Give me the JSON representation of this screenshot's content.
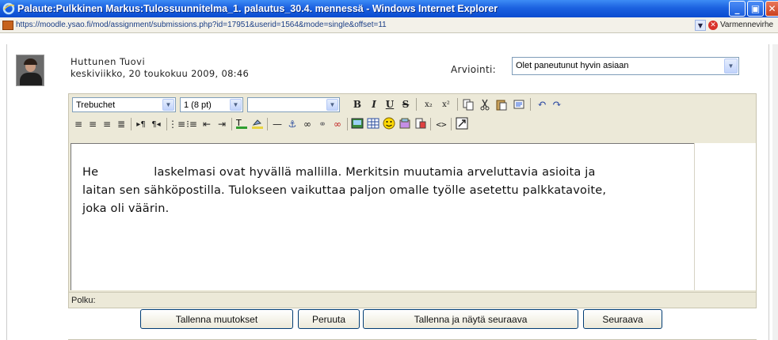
{
  "window": {
    "title": "Palaute:Pulkkinen Markus:Tulossuunnitelma_1. palautus_30.4. mennessä - Windows Internet Explorer"
  },
  "address": {
    "url": "https://moodle.ysao.fi/mod/assignment/submissions.php?id=17951&userid=1564&mode=single&offset=11",
    "cert_text": "Varmennevirhe"
  },
  "submission": {
    "user_name": "Huttunen Tuovi",
    "date": "keskiviikko, 20 toukokuu 2009, 08:46",
    "grade_label": "Arviointi:",
    "grade_value": "Olet paneutunut hyvin asiaan"
  },
  "editor": {
    "font_family": "Trebuchet",
    "font_size": "1 (8 pt)",
    "format_value": "",
    "content_line1_a": "He",
    "content_line1_b": "laskelmasi ovat hyvällä mallilla. Merkitsin  muutamia arveluttavia asioita ja",
    "content_line2": "laitan sen sähköpostilla. Tulokseen vaikuttaa paljon omalle työlle asetettu palkkatavoite,",
    "content_line3": "joka oli väärin.",
    "path_label": "Polku:"
  },
  "buttons": {
    "save": "Tallenna muutokset",
    "cancel": "Peruuta",
    "save_next": "Tallenna ja näytä seuraava",
    "next": "Seuraava"
  },
  "toolbar": {
    "bold": "B",
    "italic": "I",
    "underline": "U",
    "strike": "S"
  },
  "colors": {
    "titlebar": "#0a4bd0",
    "editor_bg": "#ece9d8",
    "button_border": "#003c74"
  }
}
